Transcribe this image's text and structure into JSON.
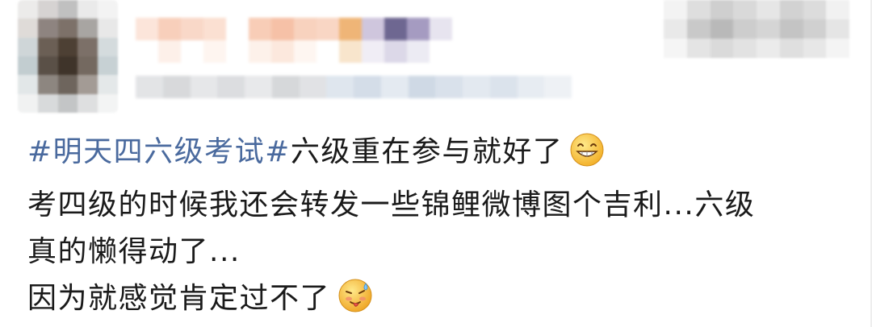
{
  "post": {
    "hashtag": "#明天四六级考试#",
    "line1_rest": "六级重在参与就好了",
    "line1_emoji": "grin-emoji",
    "line2": "考四级的时候我还会转发一些锦鲤微博图个吉利...六级",
    "line3": "真的懒得动了...",
    "line4": "因为就感觉肯定过不了",
    "line4_emoji": "sweat-tongue-emoji"
  },
  "colors": {
    "hashtag": "#4a6a9e",
    "text": "#1a1a1a",
    "background": "#ffffff"
  },
  "header": {
    "avatar_colors": [
      "#ecebea",
      "#d6d3d2",
      "#c0c0c0",
      "#eaeaea",
      "#f3f3f3",
      "#dfdbd8",
      "#8e8480",
      "#7d7169",
      "#a8a5a2",
      "#e8e8e8",
      "#cfd6d8",
      "#6b5f55",
      "#4d4034",
      "#7c7068",
      "#d4dbdd",
      "#c2cdd0",
      "#5a5047",
      "#3f342a",
      "#746960",
      "#c7d1d4",
      "#e2e7e8",
      "#8d8680",
      "#6e655d",
      "#a39b95",
      "#e4e8e9",
      "#f1f2f2",
      "#d8dadb",
      "#c3c5c6",
      "#dedfe0",
      "#f3f4f4"
    ],
    "name_colors": [
      "#fce5da",
      "#f8cfbb",
      "#f9d8c8",
      "#fbe0d2",
      "#ffffff",
      "#f8cdb7",
      "#f6c1a7",
      "#f8d2be",
      "#f9d6c4",
      "#efb577",
      "#cfc6dd",
      "#6e6791",
      "#a59bc1",
      "#e7e4ef",
      "#ffffff",
      "#fdf0e9",
      "#ffffff",
      "#fef5f0",
      "#ffffff",
      "#fdf1ea",
      "#fce8dd",
      "#fef6f1",
      "#ffffff",
      "#f8e5cc",
      "#f0edf5",
      "#dcd8e8",
      "#ecebf3",
      "#ffffff"
    ],
    "meta_colors": [
      "#e3e4e6",
      "#d8d9db",
      "#e6e7e9",
      "#dcdde0",
      "#e8e9eb",
      "#d6d8da",
      "#e1e2e5",
      "#dfe6ee",
      "#d4dde8",
      "#e4eaf1",
      "#cfd9e5",
      "#d9e1eb",
      "#e3e9f0",
      "#dbe3ec",
      "#e7ecf2",
      "#eef1f5"
    ],
    "follow_colors": [
      "#f3f3f3",
      "#dedede",
      "#cfcfcf",
      "#d9d9d9",
      "#e6e6e6",
      "#d2d2d2",
      "#dcdcdc",
      "#f1f1f1",
      "#e9e9e9",
      "#c9c9c9",
      "#b9b9b9",
      "#cdcdcd",
      "#d5d5d5",
      "#c4c4c4",
      "#d0d0d0",
      "#e5e5e5",
      "#f5f5f5",
      "#e4e4e4",
      "#dadada",
      "#e2e2e2",
      "#ebebeb",
      "#dfdfdf",
      "#e7e7e7",
      "#f4f4f4"
    ]
  }
}
